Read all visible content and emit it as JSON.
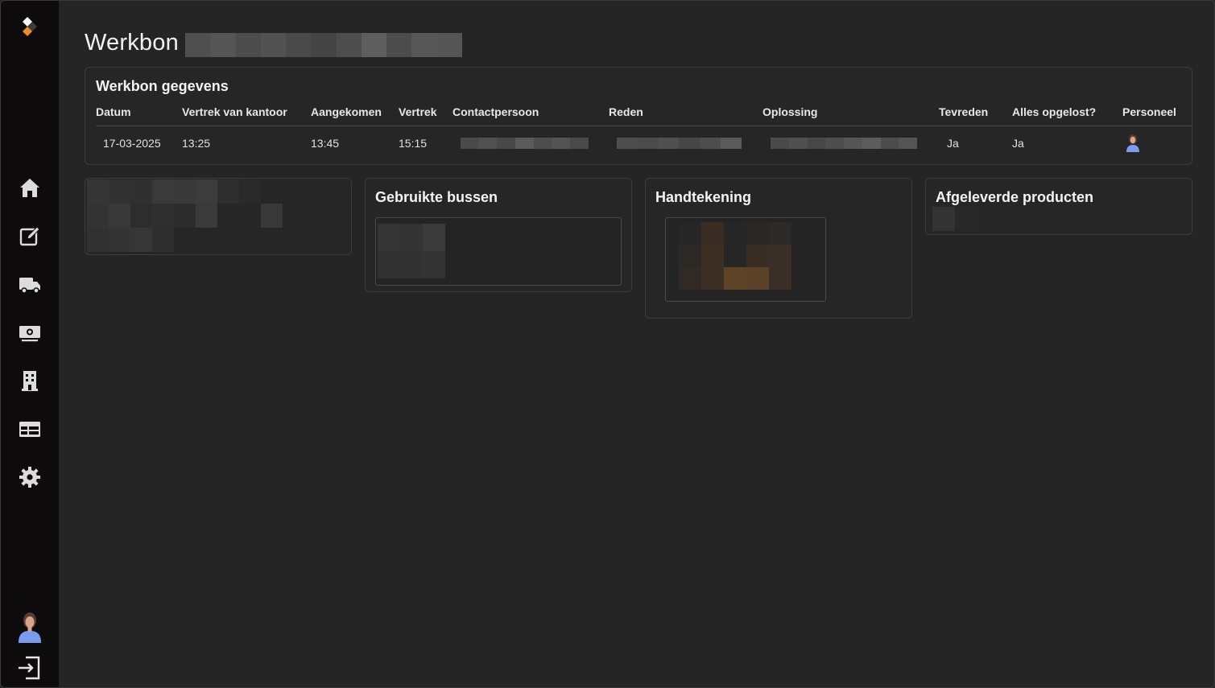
{
  "page": {
    "title": "Werkbon"
  },
  "details": {
    "title": "Werkbon gegevens",
    "columns": [
      "Datum",
      "Vertrek van kantoor",
      "Aangekomen",
      "Vertrek",
      "Contactpersoon",
      "Reden",
      "Oplossing",
      "Tevreden",
      "Alles opgelost?",
      "Personeel"
    ],
    "row": {
      "datum": "17-03-2025",
      "vertrek_kantoor": "13:25",
      "aangekomen": "13:45",
      "vertrek": "15:15",
      "tevreden": "Ja",
      "alles_opgelost": "Ja"
    }
  },
  "cards": {
    "bussen_title": "Gebruikte bussen",
    "handtekening_title": "Handtekening",
    "producten_title": "Afgeleverde producten"
  },
  "sidebar": {
    "items": [
      "home-icon",
      "edit-icon",
      "truck-icon",
      "money-icon",
      "building-icon",
      "table-icon",
      "gear-icon"
    ],
    "logout": "logout-icon"
  },
  "colors": {
    "background": "#252525",
    "sidebar": "#0d0b0b",
    "accent": "#f08a24"
  }
}
